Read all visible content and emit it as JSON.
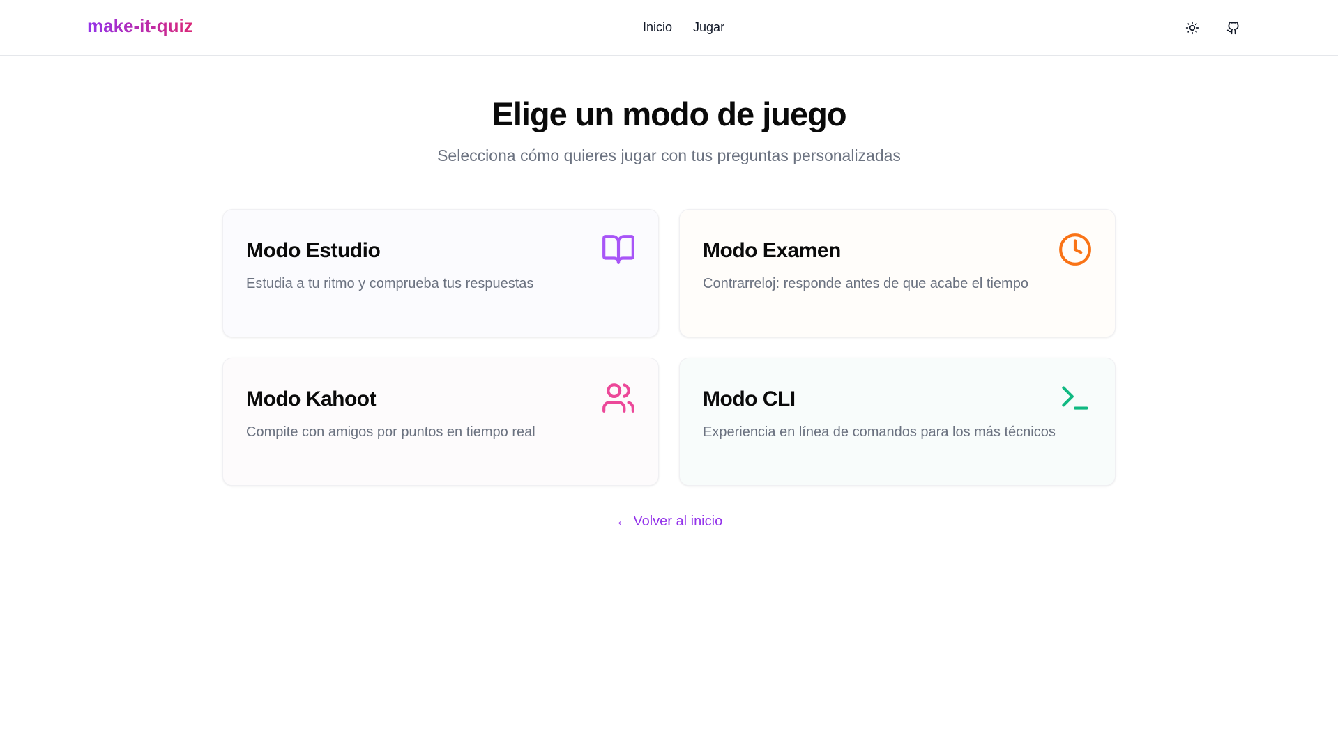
{
  "header": {
    "brand": "make-it-quiz",
    "nav": [
      {
        "label": "Inicio"
      },
      {
        "label": "Jugar"
      }
    ],
    "theme_icon": "sun-icon",
    "github_icon": "github-icon"
  },
  "main": {
    "title": "Elige un modo de juego",
    "subtitle": "Selecciona cómo quieres jugar con tus preguntas personalizadas",
    "modes": [
      {
        "title": "Modo Estudio",
        "description": "Estudia a tu ritmo y comprueba tus respuestas",
        "icon": "book-open-icon",
        "color": "#a855f7"
      },
      {
        "title": "Modo Examen",
        "description": "Contrarreloj: responde antes de que acabe el tiempo",
        "icon": "clock-icon",
        "color": "#f97316"
      },
      {
        "title": "Modo Kahoot",
        "description": "Compite con amigos por puntos en tiempo real",
        "icon": "users-icon",
        "color": "#ec4899"
      },
      {
        "title": "Modo CLI",
        "description": "Experiencia en línea de comandos para los más técnicos",
        "icon": "terminal-icon",
        "color": "#10b981"
      }
    ],
    "back_link": "← Volver al inicio"
  },
  "colors": {
    "accent": "#9333ea",
    "brand_gradient_start": "#9333ea",
    "brand_gradient_end": "#db2777",
    "muted_text": "#6b7280"
  }
}
